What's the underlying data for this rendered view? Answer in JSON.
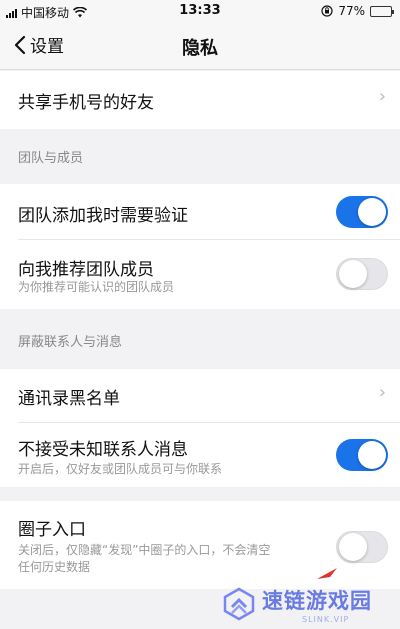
{
  "status_bar": {
    "carrier": "中国移动",
    "time": "13:33",
    "battery_percent": "77%"
  },
  "nav": {
    "back_label": "设置",
    "title": "隐私"
  },
  "rows": {
    "share_phone": {
      "title": "共享手机号的好友"
    },
    "team_header": "团队与成员",
    "team_verify": {
      "title": "团队添加我时需要验证",
      "enabled": true
    },
    "recommend_members": {
      "title": "向我推荐团队成员",
      "subtitle": "为你推荐可能认识的团队成员",
      "enabled": false
    },
    "block_header": "屏蔽联系人与消息",
    "blacklist": {
      "title": "通讯录黑名单"
    },
    "unknown_msg": {
      "title": "不接受未知联系人消息",
      "subtitle": "开启后，仅好友或团队成员可与你联系",
      "enabled": true
    },
    "circle_entry": {
      "title": "圈子入口",
      "subtitle_line1": "关闭后，仅隐藏“发现”中圈子的入口，不会清空",
      "subtitle_line2": "任何历史数据",
      "enabled": false
    }
  },
  "watermark": {
    "main": "速链游戏园",
    "sub": "SLINK.VIP"
  },
  "colors": {
    "toggle_on": "#1a73e8",
    "toggle_off": "#e5e5ea",
    "background": "#f2f2f5"
  }
}
